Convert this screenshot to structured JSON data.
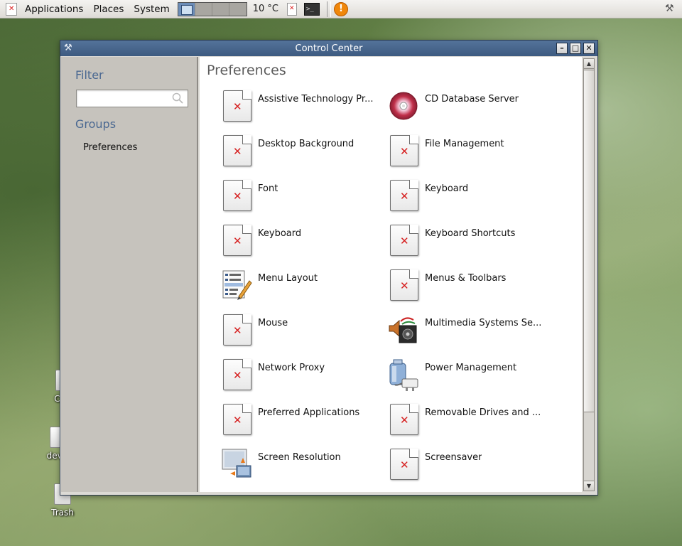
{
  "panel": {
    "menus": [
      "Applications",
      "Places",
      "System"
    ],
    "weather": "10 °C"
  },
  "desktop": {
    "icons": [
      "Com",
      "devel",
      "Trash"
    ]
  },
  "window": {
    "title": "Control Center",
    "buttons": [
      "minimize",
      "maximize",
      "close"
    ]
  },
  "sidebar": {
    "filter_title": "Filter",
    "search_value": "",
    "groups_title": "Groups",
    "group_items": [
      "Preferences"
    ]
  },
  "content": {
    "section_title": "Preferences",
    "items": [
      {
        "label": "Assistive Technology Pr...",
        "icon": "broken-image-icon"
      },
      {
        "label": "CD Database Server",
        "icon": "cd-icon"
      },
      {
        "label": "Desktop Background",
        "icon": "broken-image-icon"
      },
      {
        "label": "File Management",
        "icon": "broken-image-icon"
      },
      {
        "label": "Font",
        "icon": "broken-image-icon"
      },
      {
        "label": "Keyboard",
        "icon": "broken-image-icon"
      },
      {
        "label": "Keyboard",
        "icon": "broken-image-icon"
      },
      {
        "label": "Keyboard Shortcuts",
        "icon": "broken-image-icon"
      },
      {
        "label": "Menu Layout",
        "icon": "menu-layout-icon"
      },
      {
        "label": "Menus & Toolbars",
        "icon": "broken-image-icon"
      },
      {
        "label": "Mouse",
        "icon": "broken-image-icon"
      },
      {
        "label": "Multimedia Systems Se...",
        "icon": "multimedia-icon"
      },
      {
        "label": "Network Proxy",
        "icon": "broken-image-icon"
      },
      {
        "label": "Power Management",
        "icon": "power-plug-icon"
      },
      {
        "label": "Preferred Applications",
        "icon": "broken-image-icon"
      },
      {
        "label": "Removable Drives and ...",
        "icon": "broken-image-icon"
      },
      {
        "label": "Screen Resolution",
        "icon": "screen-resolution-icon"
      },
      {
        "label": "Screensaver",
        "icon": "broken-image-icon"
      }
    ]
  },
  "colors": {
    "titlebar": "#3d5a80",
    "sidebar_heading": "#4a6891",
    "error_x": "#d62020"
  }
}
